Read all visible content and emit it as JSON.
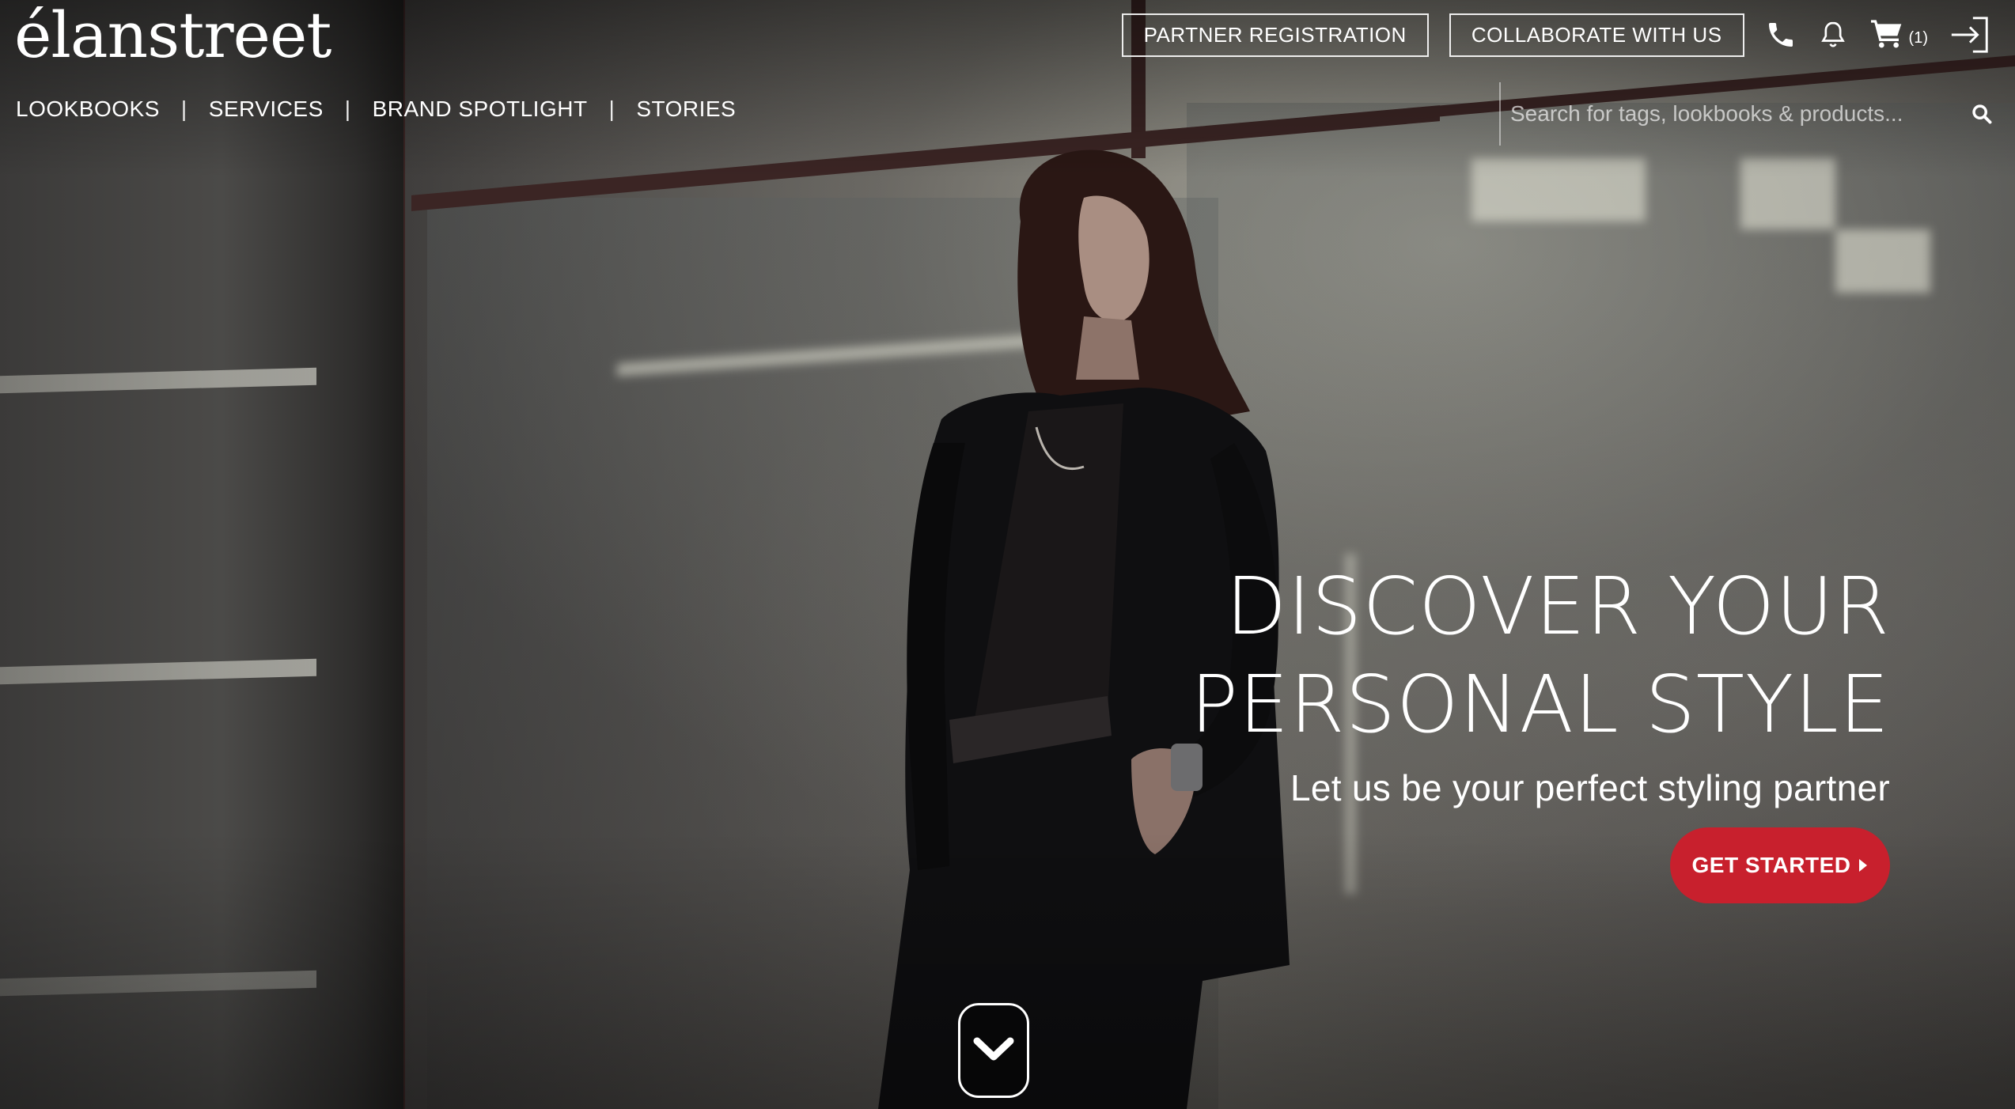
{
  "brand": {
    "logo_text": "élanstreet"
  },
  "header": {
    "partner_registration_label": "PARTNER REGISTRATION",
    "collaborate_label": "COLLABORATE WITH US",
    "cart_count": "(1)"
  },
  "nav": {
    "items": [
      {
        "label": "LOOKBOOKS"
      },
      {
        "label": "SERVICES"
      },
      {
        "label": "BRAND SPOTLIGHT"
      },
      {
        "label": "STORIES"
      }
    ],
    "separator": "|"
  },
  "search": {
    "value": "",
    "placeholder": "Search for tags, lookbooks & products..."
  },
  "hero": {
    "title_line1": "DISCOVER YOUR",
    "title_line2": "PERSONAL STYLE",
    "subtitle": "Let us be your perfect styling partner",
    "cta_label": "GET STARTED"
  },
  "icons": {
    "phone": "phone-icon",
    "notifications": "bell-icon",
    "cart": "cart-icon",
    "login": "sign-in-icon",
    "search": "search-icon",
    "cta_arrow": "caret-right-icon",
    "scroll": "chevron-down-icon"
  },
  "colors": {
    "accent": "#c8202d",
    "text": "#ffffff"
  }
}
